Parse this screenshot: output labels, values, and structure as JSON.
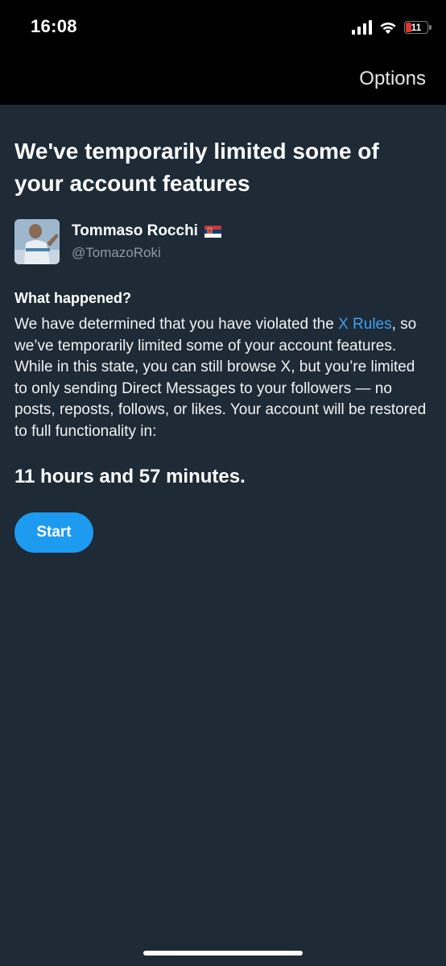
{
  "status_bar": {
    "time": "16:08",
    "battery_level": "11",
    "battery_color": "#e0362f"
  },
  "nav": {
    "options_label": "Options"
  },
  "page": {
    "title": "We've temporarily limited some of your account features"
  },
  "profile": {
    "display_name": "Tommaso Rocchi",
    "flag": "serbia-flag-icon",
    "handle": "@TomazoRoki"
  },
  "notice": {
    "heading": "What happened?",
    "body_before_link": "We have determined that you have violated the ",
    "link_text": "X Rules",
    "body_after_link": ", so we’ve temporarily limited some of your account features. While in this state, you can still browse X, but you’re limited to only sending Direct Messages to your followers — no posts, reposts, follows, or likes. Your account will be restored to full functionality in:",
    "countdown": "11 hours and 57 minutes."
  },
  "actions": {
    "start_label": "Start"
  },
  "colors": {
    "background": "#1e2a36",
    "accent": "#1d9bf0",
    "link": "#3ca0ef"
  }
}
